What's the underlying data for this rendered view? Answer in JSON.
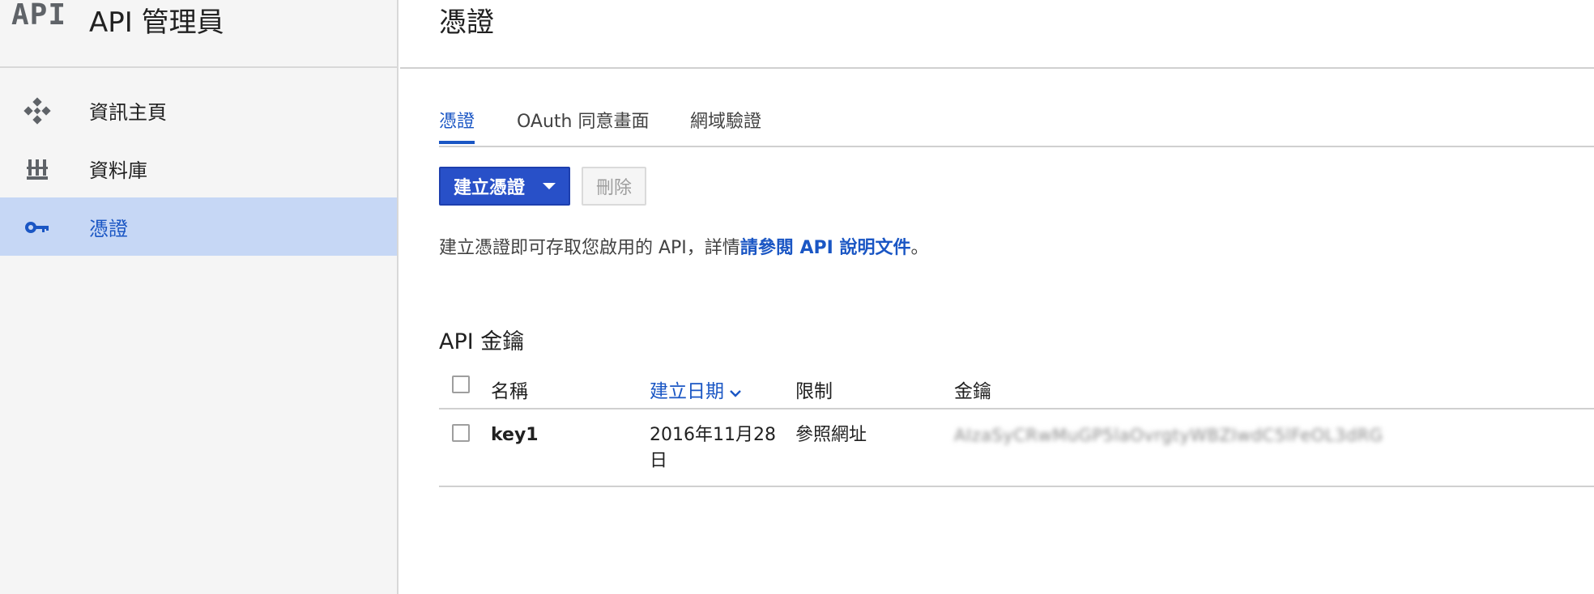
{
  "app": {
    "logo": "API",
    "title": "API 管理員"
  },
  "sidebar": {
    "items": [
      {
        "label": "資訊主頁",
        "icon": "dashboard-icon",
        "active": false
      },
      {
        "label": "資料庫",
        "icon": "library-icon",
        "active": false
      },
      {
        "label": "憑證",
        "icon": "key-icon",
        "active": true
      }
    ]
  },
  "main": {
    "title": "憑證",
    "tabs": [
      {
        "label": "憑證",
        "active": true
      },
      {
        "label": "OAuth 同意畫面",
        "active": false
      },
      {
        "label": "網域驗證",
        "active": false
      }
    ],
    "toolbar": {
      "create_label": "建立憑證",
      "delete_label": "刪除"
    },
    "info": {
      "prefix": "建立憑證即可存取您啟用的 API，詳情",
      "link": "請參閱 API 說明文件",
      "suffix": "。"
    },
    "section_title": "API 金鑰",
    "table": {
      "columns": [
        "名稱",
        "建立日期",
        "限制",
        "金鑰"
      ],
      "sorted_column": "建立日期",
      "rows": [
        {
          "name": "key1",
          "created_line1": "2016年11月28",
          "created_line2": "日",
          "restriction": "參照網址",
          "key": "AIzaSyCRwMuGP5laOvrgtyWBZIwdC5lFeOL3dRG"
        }
      ]
    }
  },
  "colors": {
    "accent": "#1a56c4",
    "button": "#2850c8",
    "active_nav_bg": "#c6d7f5"
  }
}
